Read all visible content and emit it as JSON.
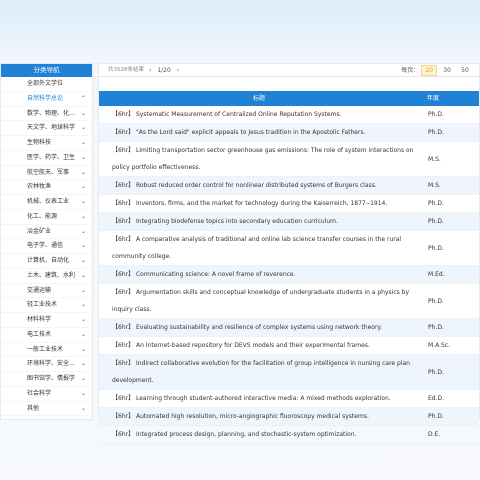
{
  "sidebar": {
    "header": "分类导航",
    "items": [
      {
        "label": "全部外文学位",
        "chevron": false,
        "active": false
      },
      {
        "label": "自然科学总论",
        "chevron": true,
        "active": true
      },
      {
        "label": "数学、物理、化…",
        "chevron": true,
        "active": false
      },
      {
        "label": "天文学、地球科学",
        "chevron": true,
        "active": false
      },
      {
        "label": "生物科技",
        "chevron": true,
        "active": false
      },
      {
        "label": "医学、药学、卫生",
        "chevron": true,
        "active": false
      },
      {
        "label": "航空航天、军事",
        "chevron": true,
        "active": false
      },
      {
        "label": "农林牧渔",
        "chevron": true,
        "active": false
      },
      {
        "label": "机械、仪表工业",
        "chevron": true,
        "active": false
      },
      {
        "label": "化工、能源",
        "chevron": true,
        "active": false
      },
      {
        "label": "冶金矿业",
        "chevron": true,
        "active": false
      },
      {
        "label": "电子学、通信",
        "chevron": true,
        "active": false
      },
      {
        "label": "计算机、自动化",
        "chevron": true,
        "active": false
      },
      {
        "label": "土木、建筑、水利",
        "chevron": true,
        "active": false
      },
      {
        "label": "交通运输",
        "chevron": true,
        "active": false
      },
      {
        "label": "轻工业技术",
        "chevron": true,
        "active": false
      },
      {
        "label": "材料科学",
        "chevron": true,
        "active": false
      },
      {
        "label": "电工技术",
        "chevron": true,
        "active": false
      },
      {
        "label": "一般工业技术",
        "chevron": true,
        "active": false
      },
      {
        "label": "环境科学、安全…",
        "chevron": true,
        "active": false
      },
      {
        "label": "图书馆学、情报学",
        "chevron": true,
        "active": false
      },
      {
        "label": "社会科学",
        "chevron": true,
        "active": false
      },
      {
        "label": "其他",
        "chevron": true,
        "active": false
      }
    ]
  },
  "toolbar": {
    "result_count": "共3528条结果",
    "prev": "‹",
    "page": "1/20",
    "next": "›",
    "per_page_label": "每页：",
    "per_page_options": [
      "20",
      "30",
      "50"
    ],
    "per_page_selected": "20"
  },
  "table": {
    "col_title": "标题",
    "col_degree": "年度",
    "rows": [
      {
        "title": "【6hr】 Systematic Measurement of Centralized Online Reputation Systems.",
        "degree": "Ph.D.",
        "tall": false
      },
      {
        "title": "【6hr】 \"As the Lord said\" explicit appeals to Jesus tradition in the Apostolic Fathers.",
        "degree": "Ph.D.",
        "tall": false
      },
      {
        "title": "【6hr】 Limiting transportation sector greenhouse gas emissions: The role of system interactions on policy portfolio effectiveness.",
        "degree": "M.S.",
        "tall": true
      },
      {
        "title": "【6hr】 Robust reduced order control for nonlinear distributed systems of Burgers class.",
        "degree": "M.S.",
        "tall": false
      },
      {
        "title": "【6hr】 Inventors, firms, and the market for technology during the Kaiserreich, 1877--1914.",
        "degree": "Ph.D.",
        "tall": false
      },
      {
        "title": "【6hr】 Integrating biodefense topics into secondary education curriculum.",
        "degree": "Ph.D.",
        "tall": false
      },
      {
        "title": "【6hr】 A comparative analysis of traditional and online lab science transfer courses in the rural community college.",
        "degree": "Ph.D.",
        "tall": true
      },
      {
        "title": "【6hr】 Communicating science: A novel frame of reverence.",
        "degree": "M.Ed.",
        "tall": false
      },
      {
        "title": "【6hr】 Argumentation skills and conceptual knowledge of undergraduate students in a physics by inquiry class.",
        "degree": "Ph.D.",
        "tall": true
      },
      {
        "title": "【6hr】 Evaluating sustainability and resilience of complex systems using network theory.",
        "degree": "Ph.D.",
        "tall": false
      },
      {
        "title": "【6hr】 An Internet-based repository for DEVS models and their experimental frames.",
        "degree": "M.A.Sc.",
        "tall": false
      },
      {
        "title": "【6hr】 Indirect collaborative evolution for the facilitation of group intelligence in nursing care plan development.",
        "degree": "Ph.D.",
        "tall": true
      },
      {
        "title": "【6hr】 Learning through student-authored interactive media: A mixed methods exploration.",
        "degree": "Ed.D.",
        "tall": false
      },
      {
        "title": "【6hr】 Automated high resolution, micro-angiographic fluoroscopy medical systems.",
        "degree": "Ph.D.",
        "tall": false
      },
      {
        "title": "【6hr】 Integrated process design, planning, and stochastic-system optimization.",
        "degree": "D.E.",
        "tall": false
      }
    ]
  },
  "colors": {
    "accent": "#1f82d4",
    "row_alt": "#eef5fc",
    "selected_page": "#e09a1a"
  }
}
